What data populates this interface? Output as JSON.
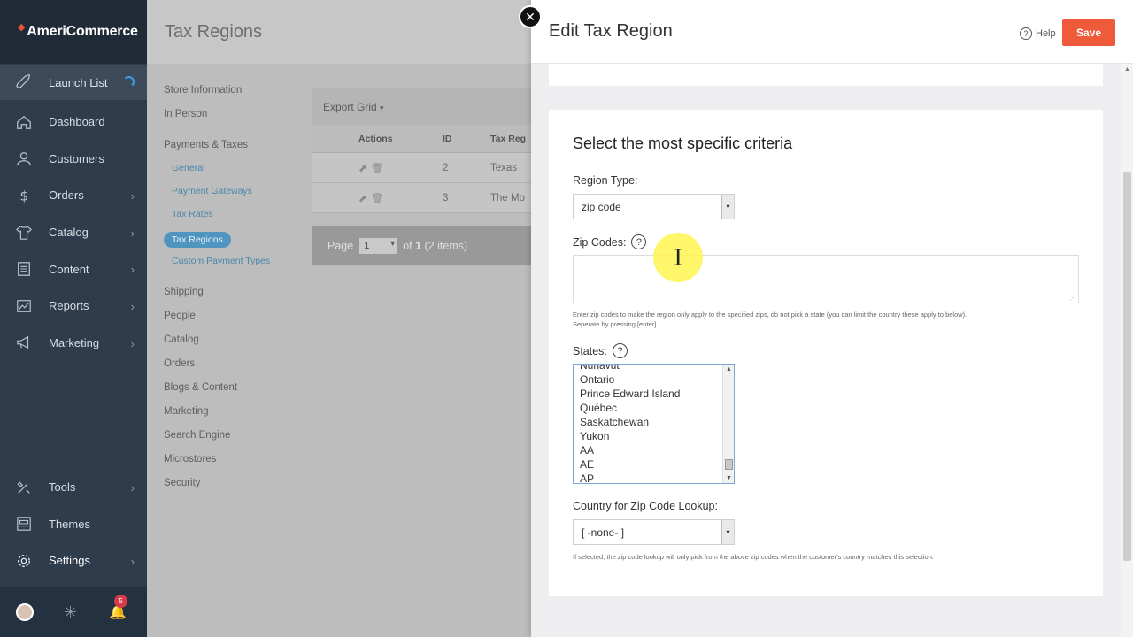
{
  "brand": "AmeriCommerce",
  "sidebar": {
    "launch": "Launch List",
    "items": [
      {
        "label": "Dashboard",
        "chevron": false
      },
      {
        "label": "Customers",
        "chevron": false
      },
      {
        "label": "Orders",
        "chevron": true
      },
      {
        "label": "Catalog",
        "chevron": true
      },
      {
        "label": "Content",
        "chevron": true
      },
      {
        "label": "Reports",
        "chevron": true
      },
      {
        "label": "Marketing",
        "chevron": true
      }
    ],
    "bottom": [
      {
        "label": "Tools",
        "chevron": true
      },
      {
        "label": "Themes",
        "chevron": false
      },
      {
        "label": "Settings",
        "chevron": true
      }
    ],
    "notifications": "5"
  },
  "main": {
    "title": "Tax Regions",
    "subnav": [
      "Store Information",
      "In Person",
      "Payments & Taxes",
      "General",
      "Payment Gateways",
      "Tax Rates",
      "Tax Regions",
      "Custom Payment Types",
      "Shipping",
      "People",
      "Catalog",
      "Orders",
      "Blogs & Content",
      "Marketing",
      "Search Engine",
      "Microstores",
      "Security"
    ],
    "grid": {
      "export": "Export Grid",
      "columns": {
        "actions": "Actions",
        "id": "ID",
        "name": "Tax Reg"
      },
      "rows": [
        {
          "id": "2",
          "name": "Texas"
        },
        {
          "id": "3",
          "name": "The Mo"
        }
      ],
      "pager": {
        "page_label": "Page",
        "page": "1",
        "of_prefix": "of ",
        "total": "1",
        "items": " (2 items)"
      }
    }
  },
  "panel": {
    "title": "Edit Tax Region",
    "help": "Help",
    "save": "Save",
    "card_title": "Select the most specific criteria",
    "region_type_label": "Region Type:",
    "region_type_value": "zip code",
    "zip_label": "Zip Codes:",
    "zip_hint_1": "Enter zip codes to make the region only apply to the specified zips, do not pick a state (you can limit the country these apply to below).",
    "zip_hint_2": "Seperate by pressing [enter]",
    "states_label": "States:",
    "states": [
      "Nunavut",
      "Ontario",
      "Prince Edward Island",
      "Québec",
      "Saskatchewan",
      "Yukon",
      "AA",
      "AE",
      "AP"
    ],
    "country_label": "Country for Zip Code Lookup:",
    "country_value": "[ -none- ]",
    "country_hint": "If selected, the zip code lookup will only pick from the above zip codes when the customer's country matches this selection."
  }
}
